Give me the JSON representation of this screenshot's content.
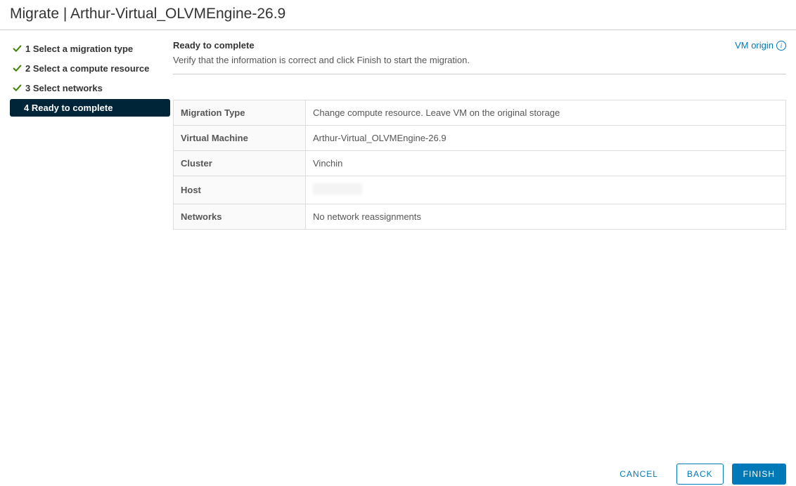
{
  "dialog": {
    "title": "Migrate | Arthur-Virtual_OLVMEngine-26.9"
  },
  "wizard": {
    "steps": [
      {
        "label": "1 Select a migration type"
      },
      {
        "label": "2 Select a compute resource"
      },
      {
        "label": "3 Select networks"
      },
      {
        "label": "4 Ready to complete"
      }
    ]
  },
  "content": {
    "heading": "Ready to complete",
    "subheading": "Verify that the information is correct and click Finish to start the migration.",
    "vm_origin_label": "VM origin"
  },
  "summary": {
    "rows": [
      {
        "label": "Migration Type",
        "value": "Change compute resource. Leave VM on the original storage"
      },
      {
        "label": "Virtual Machine",
        "value": "Arthur-Virtual_OLVMEngine-26.9"
      },
      {
        "label": "Cluster",
        "value": "Vinchin"
      },
      {
        "label": "Host",
        "value": ""
      },
      {
        "label": "Networks",
        "value": "No network reassignments"
      }
    ]
  },
  "footer": {
    "cancel": "CANCEL",
    "back": "BACK",
    "finish": "FINISH"
  }
}
